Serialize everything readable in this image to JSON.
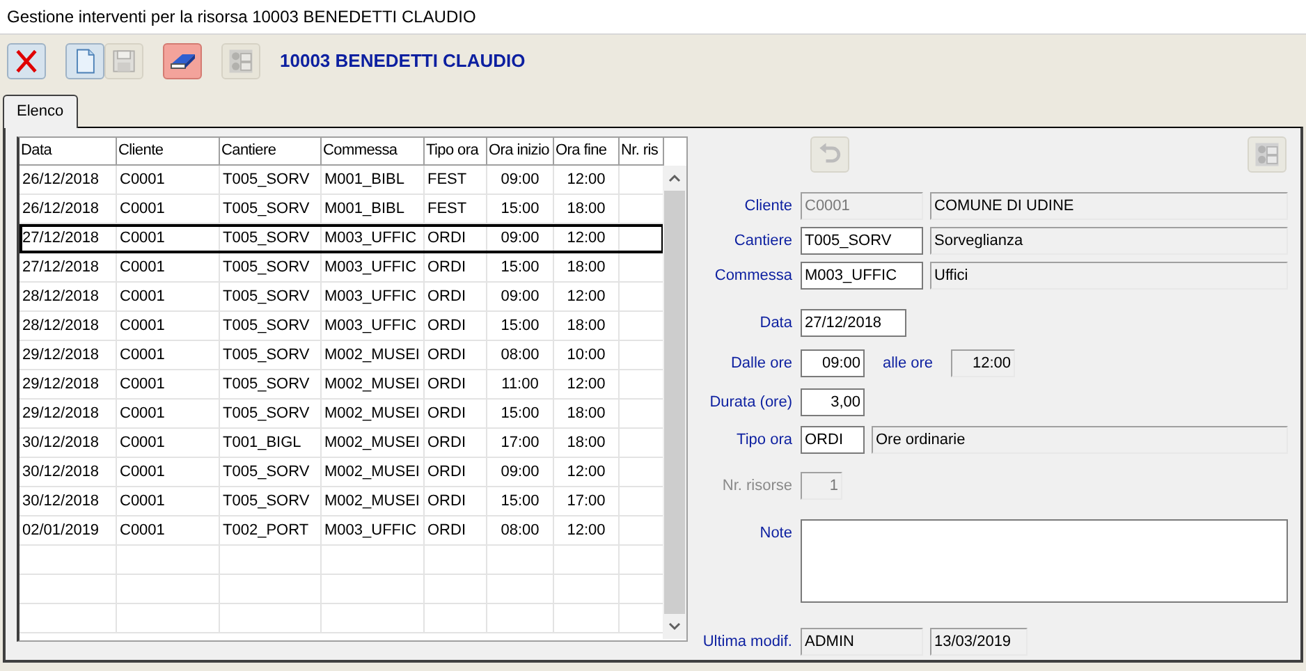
{
  "window": {
    "title": "Gestione interventi per la risorsa 10003 BENEDETTI CLAUDIO"
  },
  "toolbar": {
    "buttons": [
      {
        "kind": "delete",
        "disabled": false
      },
      {
        "kind": "new",
        "disabled": false
      },
      {
        "kind": "save",
        "disabled": true
      },
      {
        "kind": "clear",
        "disabled": false
      },
      {
        "kind": "report",
        "disabled": true
      }
    ],
    "resource": "10003 BENEDETTI CLAUDIO"
  },
  "tabs": [
    {
      "label": "Elenco",
      "selected": true
    }
  ],
  "table": {
    "columns": [
      "Data",
      "Cliente",
      "Cantiere",
      "Commessa",
      "Tipo ora",
      "Ora inizio",
      "Ora fine",
      "Nr. ris"
    ],
    "rows": [
      {
        "cells": [
          "26/12/2018",
          "C0001",
          "T005_SORV",
          "M001_BIBL",
          "FEST",
          "09:00",
          "12:00"
        ],
        "selected": false
      },
      {
        "cells": [
          "26/12/2018",
          "C0001",
          "T005_SORV",
          "M001_BIBL",
          "FEST",
          "15:00",
          "18:00"
        ],
        "selected": false
      },
      {
        "cells": [
          "27/12/2018",
          "C0001",
          "T005_SORV",
          "M003_UFFIC",
          "ORDI",
          "09:00",
          "12:00"
        ],
        "selected": true
      },
      {
        "cells": [
          "27/12/2018",
          "C0001",
          "T005_SORV",
          "M003_UFFIC",
          "ORDI",
          "15:00",
          "18:00"
        ],
        "selected": false
      },
      {
        "cells": [
          "28/12/2018",
          "C0001",
          "T005_SORV",
          "M003_UFFIC",
          "ORDI",
          "09:00",
          "12:00"
        ],
        "selected": false
      },
      {
        "cells": [
          "28/12/2018",
          "C0001",
          "T005_SORV",
          "M003_UFFIC",
          "ORDI",
          "15:00",
          "18:00"
        ],
        "selected": false
      },
      {
        "cells": [
          "29/12/2018",
          "C0001",
          "T005_SORV",
          "M002_MUSEI",
          "ORDI",
          "08:00",
          "10:00"
        ],
        "selected": false
      },
      {
        "cells": [
          "29/12/2018",
          "C0001",
          "T005_SORV",
          "M002_MUSEI",
          "ORDI",
          "11:00",
          "12:00"
        ],
        "selected": false
      },
      {
        "cells": [
          "29/12/2018",
          "C0001",
          "T005_SORV",
          "M002_MUSEI",
          "ORDI",
          "15:00",
          "18:00"
        ],
        "selected": false
      },
      {
        "cells": [
          "30/12/2018",
          "C0001",
          "T001_BIGL",
          "M002_MUSEI",
          "ORDI",
          "17:00",
          "18:00"
        ],
        "selected": false
      },
      {
        "cells": [
          "30/12/2018",
          "C0001",
          "T005_SORV",
          "M002_MUSEI",
          "ORDI",
          "09:00",
          "12:00"
        ],
        "selected": false
      },
      {
        "cells": [
          "30/12/2018",
          "C0001",
          "T005_SORV",
          "M002_MUSEI",
          "ORDI",
          "15:00",
          "17:00"
        ],
        "selected": false
      },
      {
        "cells": [
          "02/01/2019",
          "C0001",
          "T002_PORT",
          "M003_UFFIC",
          "ORDI",
          "08:00",
          "12:00"
        ],
        "selected": false
      }
    ]
  },
  "form": {
    "top_buttons": [
      {
        "kind": "undo",
        "disabled": true
      },
      {
        "kind": "report",
        "disabled": true
      }
    ],
    "rows": [
      {
        "label": "Cliente",
        "disabled": false,
        "items": [
          {
            "kind": "code",
            "value": "C0001",
            "disabled": true,
            "readonly": true
          },
          {
            "kind": "description",
            "value": "COMUNE DI UDINE",
            "readonly": true
          }
        ]
      },
      {
        "label": "Cantiere",
        "disabled": false,
        "items": [
          {
            "kind": "code",
            "value": "T005_SORV",
            "disabled": false,
            "readonly": false
          },
          {
            "kind": "description",
            "value": "Sorveglianza",
            "readonly": true
          }
        ]
      },
      {
        "label": "Commessa",
        "disabled": false,
        "items": [
          {
            "kind": "code",
            "value": "M003_UFFIC",
            "disabled": false,
            "readonly": false
          },
          {
            "kind": "description",
            "value": "Uffici",
            "readonly": true
          }
        ]
      },
      {
        "label": "Data",
        "disabled": false,
        "items": [
          {
            "kind": "date",
            "value": "27/12/2018",
            "readonly": false
          }
        ]
      },
      {
        "label": "Dalle ore",
        "disabled": false,
        "items": [
          {
            "kind": "time",
            "value": "09:00",
            "readonly": false
          },
          {
            "kind": "caption",
            "text": "alle ore"
          },
          {
            "kind": "time",
            "value": "12:00",
            "readonly": true
          }
        ]
      },
      {
        "label": "Durata (ore)",
        "disabled": false,
        "items": [
          {
            "kind": "time",
            "value": "3,00",
            "readonly": false
          }
        ]
      },
      {
        "label": "Tipo ora",
        "disabled": false,
        "items": [
          {
            "kind": "short",
            "value": "ORDI",
            "readonly": false
          },
          {
            "kind": "description",
            "value": "Ore ordinarie",
            "readonly": true
          }
        ]
      },
      {
        "label": "Nr. risorse",
        "disabled": true,
        "items": [
          {
            "kind": "tiny",
            "value": "1",
            "disabled": true,
            "readonly": true
          }
        ]
      },
      {
        "label": "Note",
        "disabled": false,
        "items": [
          {
            "kind": "memo"
          }
        ]
      },
      {
        "label": "Ultima modif.",
        "disabled": false,
        "items": [
          {
            "kind": "user",
            "value": "ADMIN",
            "readonly": true
          },
          {
            "kind": "stamp",
            "value": "13/03/2019",
            "readonly": true
          }
        ]
      }
    ]
  }
}
